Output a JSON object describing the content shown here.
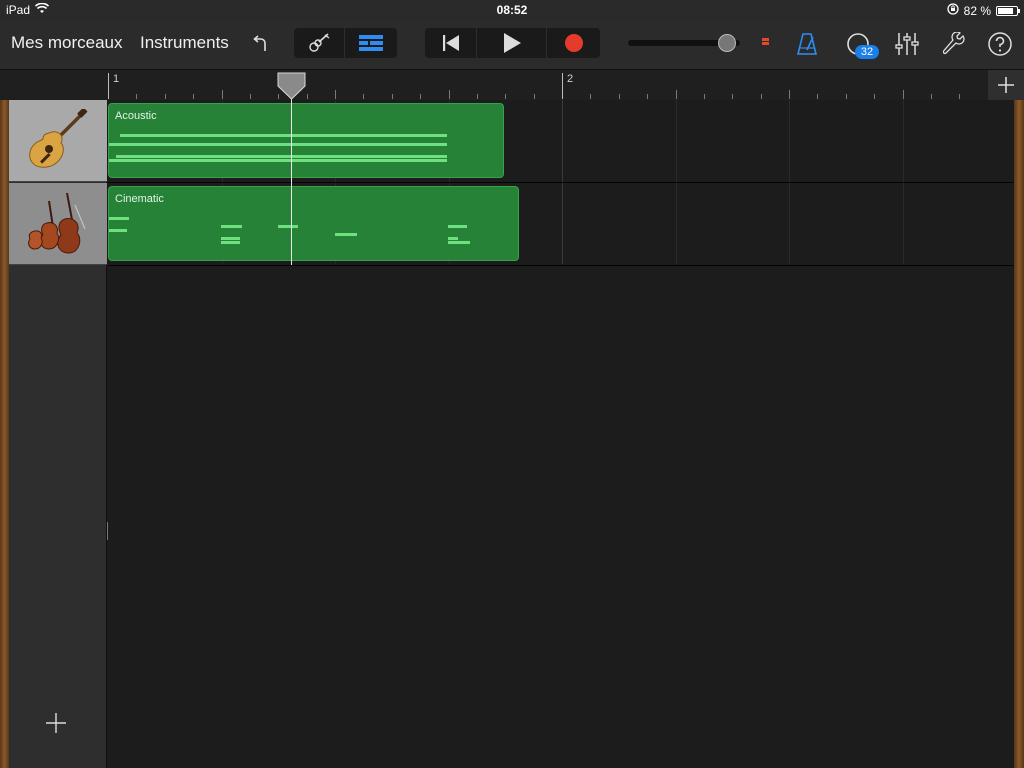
{
  "status_bar": {
    "device": "iPad",
    "time": "08:52",
    "battery": "82 %",
    "battery_level": 0.82
  },
  "toolbar": {
    "my_songs_label": "Mes morceaux",
    "instruments_label": "Instruments",
    "loops_count": "32",
    "volume_level": 0.95
  },
  "ruler": {
    "bars": [
      "1",
      "2"
    ]
  },
  "tracks": [
    {
      "region_name": "Acoustic",
      "instrument_icon": "acoustic-guitar-icon",
      "selected": true
    },
    {
      "region_name": "Cinematic",
      "instrument_icon": "string-ensemble-icon",
      "selected": false
    }
  ],
  "colors": {
    "region": "#258236",
    "note": "#6ee080",
    "record": "#e53b2c",
    "accent": "#1a7fe8"
  }
}
